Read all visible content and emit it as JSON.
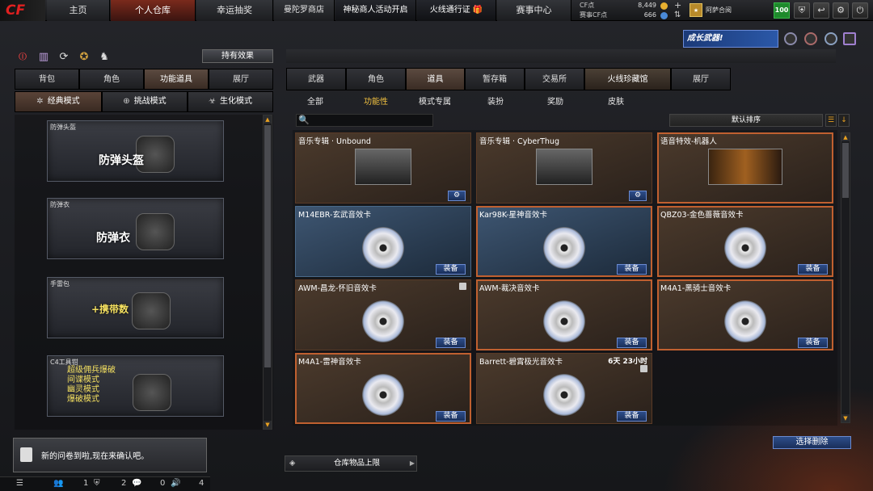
{
  "topbar": {
    "logo": "CF",
    "nav": [
      "主页",
      "个人仓库",
      "幸运抽奖",
      "曼陀罗商店",
      "神秘商人活动开启",
      "火线通行证",
      "赛事中心"
    ],
    "cf_label": "CF点",
    "cf_value": "8,449",
    "cf_match_label": "赛事CF点",
    "cf_match_value": "666",
    "username": "阿萨合阅",
    "level": "100"
  },
  "banner": {
    "text": "成长武器!"
  },
  "left": {
    "effect_button": "持有效果",
    "tabs": [
      "背包",
      "角色",
      "功能道具",
      "展厅"
    ],
    "modes": [
      "经典模式",
      "挑战模式",
      "生化模式"
    ],
    "cards": [
      {
        "label": "防弹头盔",
        "title": "防弹头盔"
      },
      {
        "label": "防弹衣",
        "title": "防弹衣"
      },
      {
        "label": "手雷包",
        "title": "+携带数"
      },
      {
        "label": "C4工具钳",
        "lines": [
          "超级佣兵爆破",
          "间谍模式",
          "幽灵模式",
          "爆破模式"
        ]
      }
    ]
  },
  "notify": {
    "text": "新的问卷到啦,现在来确认吧。"
  },
  "bottom": {
    "counts": [
      "1",
      "2",
      "0",
      "4"
    ]
  },
  "right": {
    "tabs": [
      "武器",
      "角色",
      "道具",
      "暂存箱",
      "交易所",
      "火线珍藏馆",
      "展厅"
    ],
    "subtabs": [
      "全部",
      "功能性",
      "模式专属",
      "装扮",
      "奖励",
      "皮肤"
    ],
    "sort_label": "默认排序",
    "items": [
      {
        "name": "音乐专辑 · Unbound",
        "type": "album"
      },
      {
        "name": "音乐专辑 · CyberThug",
        "type": "album"
      },
      {
        "name": "语音特效-机器人",
        "type": "voice"
      },
      {
        "name": "M14EBR-玄武音效卡",
        "type": "card",
        "button": "装备"
      },
      {
        "name": "Kar98K-星神音效卡",
        "type": "card",
        "button": "装备"
      },
      {
        "name": "QBZ03-金色蔷薇音效卡",
        "type": "card",
        "button": "装备"
      },
      {
        "name": "AWM-昌龙-怀旧音效卡",
        "type": "card",
        "button": "装备"
      },
      {
        "name": "AWM-裁决音效卡",
        "type": "card",
        "button": "装备"
      },
      {
        "name": "M4A1-黑骑士音效卡",
        "type": "card",
        "button": "装备"
      },
      {
        "name": "M4A1-雷神音效卡",
        "type": "card",
        "button": "装备"
      },
      {
        "name": "Barrett-碧霄极光音效卡",
        "type": "card",
        "button": "装备",
        "timer": "6天 23小时"
      }
    ],
    "delete_button": "选择删除",
    "capacity_label": "仓库物品上限"
  }
}
